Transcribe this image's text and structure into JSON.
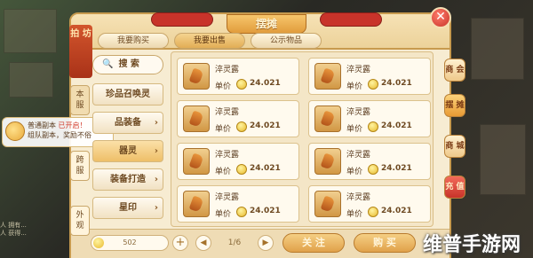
{
  "panel": {
    "title": "摆摊",
    "tabs": [
      {
        "label": "我要购买",
        "active": false
      },
      {
        "label": "我要出售",
        "active": true
      },
      {
        "label": "公示物品",
        "active": false
      }
    ],
    "close_label": "✕"
  },
  "left_ribbon": "拍 坊",
  "server_tabs": [
    {
      "label": "本 服",
      "active": true
    },
    {
      "label": "跨 服",
      "active": false
    },
    {
      "label": "外 观",
      "active": false
    }
  ],
  "search": {
    "label": "搜 索"
  },
  "categories": [
    {
      "label": "珍品召唤灵",
      "active": false
    },
    {
      "label": "品装备",
      "active": false
    },
    {
      "label": "器灵",
      "active": true
    },
    {
      "label": "装备打造",
      "active": false
    },
    {
      "label": "星印",
      "active": false
    }
  ],
  "items": [
    {
      "name": "淬灵露",
      "price_label": "单价",
      "price": "24.021"
    },
    {
      "name": "淬灵露",
      "price_label": "单价",
      "price": "24.021"
    },
    {
      "name": "淬灵露",
      "price_label": "单价",
      "price": "24.021"
    },
    {
      "name": "淬灵露",
      "price_label": "单价",
      "price": "24.021"
    },
    {
      "name": "淬灵露",
      "price_label": "单价",
      "price": "24.021"
    },
    {
      "name": "淬灵露",
      "price_label": "单价",
      "price": "24.021"
    },
    {
      "name": "淬灵露",
      "price_label": "单价",
      "price": "24.021"
    },
    {
      "name": "淬灵露",
      "price_label": "单价",
      "price": "24.021"
    }
  ],
  "right_tabs": [
    {
      "label": "商 会",
      "style": "normal"
    },
    {
      "label": "摆 摊",
      "style": "active"
    },
    {
      "label": "商 城",
      "style": "normal"
    },
    {
      "label": "充 值",
      "style": "recharge"
    }
  ],
  "bottom": {
    "money": "502",
    "add": "+",
    "prev": "◀",
    "page": "1/6",
    "next": "▶",
    "follow_label": "关 注",
    "buy_label": "购 买"
  },
  "chat": {
    "line1_prefix": "普通副本",
    "line1_hl": "已开启！",
    "line2": "组队副本，奖励不俗"
  },
  "chat_log": [
    "人 拥有...",
    "人 获得..."
  ],
  "watermark": "维普手游网",
  "colors": {
    "accent": "#e0a14a",
    "ribbon_red": "#c8332a",
    "panel_bg": "#f7ecd2"
  }
}
